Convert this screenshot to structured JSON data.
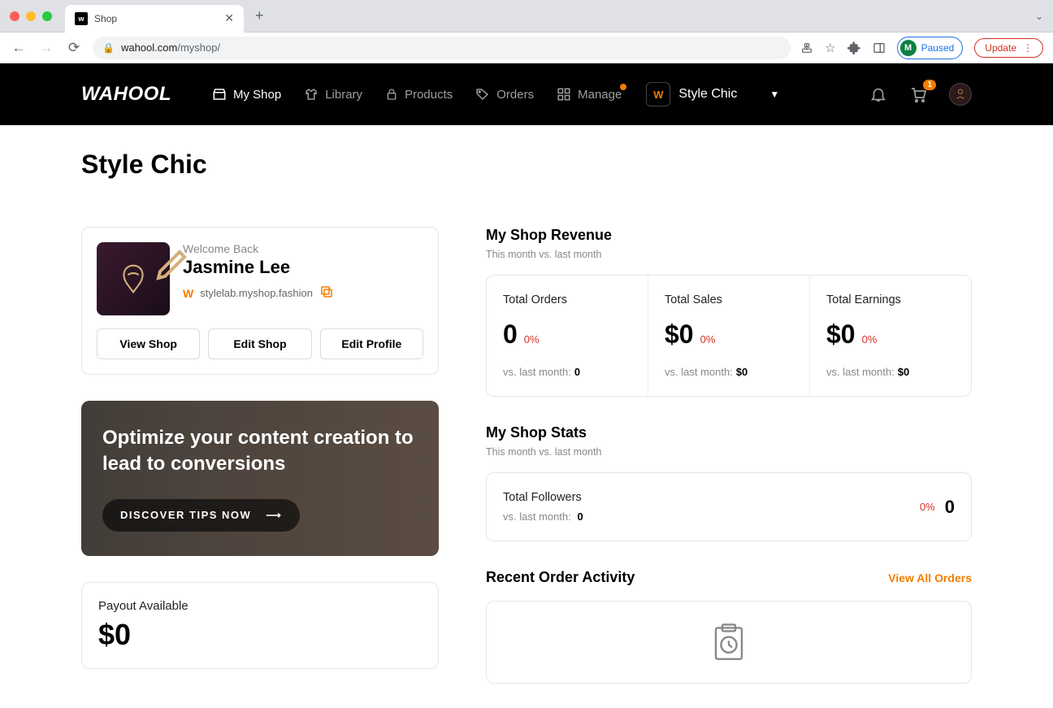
{
  "browser": {
    "tab_title": "Shop",
    "url_domain": "wahool.com",
    "url_path": "/myshop/",
    "paused_label": "Paused",
    "paused_initial": "M",
    "update_label": "Update"
  },
  "header": {
    "logo": "WAHOOL",
    "nav": [
      {
        "label": "My Shop",
        "active": true,
        "icon": "shop"
      },
      {
        "label": "Library",
        "icon": "shirt"
      },
      {
        "label": "Products",
        "icon": "lock"
      },
      {
        "label": "Orders",
        "icon": "tag"
      },
      {
        "label": "Manage",
        "icon": "grid",
        "dot": true
      }
    ],
    "shop_switcher": {
      "label": "Style Chic",
      "badge": "W"
    },
    "cart_badge": "1"
  },
  "page_title": "Style Chic",
  "profile": {
    "welcome": "Welcome Back",
    "name": "Jasmine Lee",
    "url": "stylelab.myshop.fashion",
    "actions": {
      "view": "View Shop",
      "edit_shop": "Edit Shop",
      "edit_profile": "Edit Profile"
    }
  },
  "promo": {
    "title1": "Optimize your content creation to",
    "title2": "lead to conversions",
    "cta": "DISCOVER TIPS NOW"
  },
  "payout": {
    "label": "Payout Available",
    "value": "$0"
  },
  "revenue": {
    "title": "My Shop Revenue",
    "subtitle": "This month vs. last month",
    "cols": [
      {
        "label": "Total Orders",
        "value": "0",
        "pct": "0%",
        "vs_label": "vs. last month:",
        "vs_value": "0"
      },
      {
        "label": "Total Sales",
        "value": "$0",
        "pct": "0%",
        "vs_label": "vs. last month:",
        "vs_value": "$0"
      },
      {
        "label": "Total Earnings",
        "value": "$0",
        "pct": "0%",
        "vs_label": "vs. last month:",
        "vs_value": "$0"
      }
    ]
  },
  "stats": {
    "title": "My Shop Stats",
    "subtitle": "This month vs. last month",
    "followers_label": "Total Followers",
    "followers_vs_label": "vs. last month:",
    "followers_vs_value": "0",
    "followers_pct": "0%",
    "followers_value": "0"
  },
  "recent": {
    "title": "Recent Order Activity",
    "view_all": "View All Orders"
  }
}
